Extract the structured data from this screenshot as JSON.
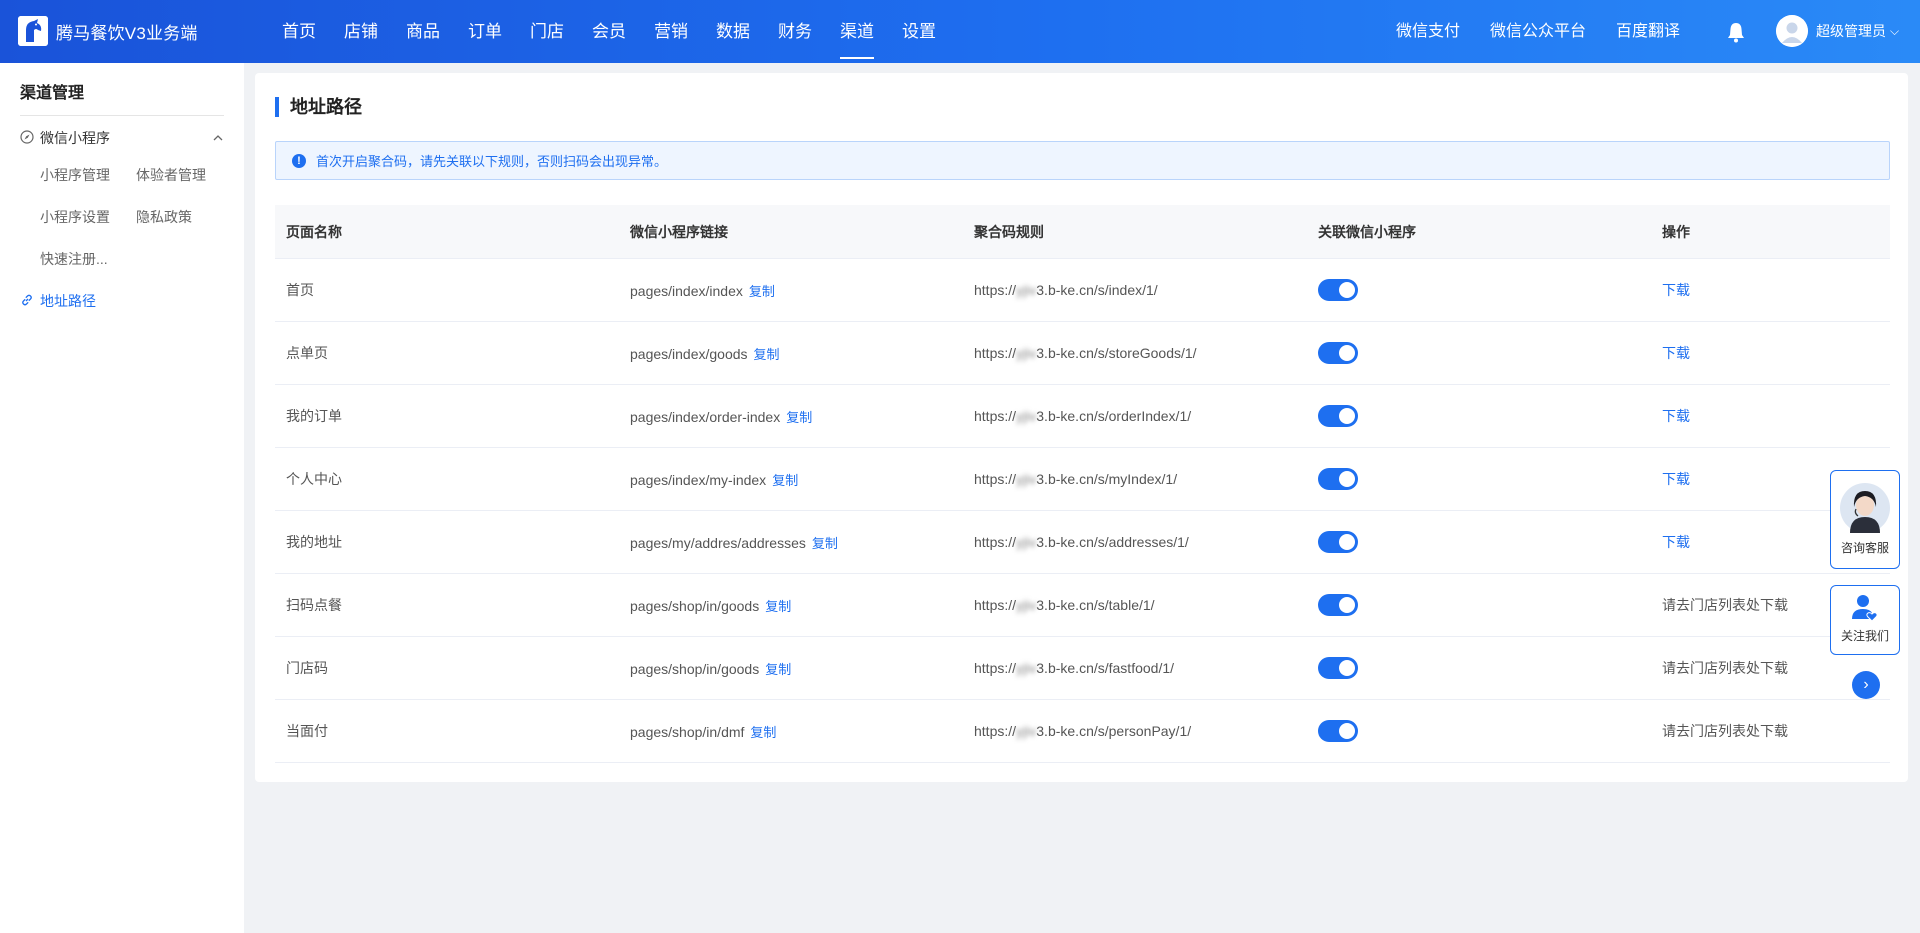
{
  "header": {
    "brand": "腾马餐饮V3业务端",
    "nav": [
      "首页",
      "店铺",
      "商品",
      "订单",
      "门店",
      "会员",
      "营销",
      "数据",
      "财务",
      "渠道",
      "设置"
    ],
    "active_nav": "渠道",
    "links": [
      "微信支付",
      "微信公众平台",
      "百度翻译"
    ],
    "user_name": "超级管理员",
    "user_caret": "⌵"
  },
  "sidebar": {
    "title": "渠道管理",
    "group_label": "微信小程序",
    "sub_items": [
      "小程序管理",
      "体验者管理",
      "小程序设置",
      "隐私政策",
      "快速注册..."
    ],
    "active_item": "地址路径"
  },
  "main": {
    "title": "地址路径",
    "notice_icon": "!",
    "notice": "首次开启聚合码，请先关联以下规则，否则扫码会出现异常。",
    "columns": [
      "页面名称",
      "微信小程序链接",
      "聚合码规则",
      "关联微信小程序",
      "操作"
    ],
    "copy_label": "复制",
    "rows": [
      {
        "name": "首页",
        "link": "pages/index/index",
        "url_prefix": "https://",
        "url_masked": "yjiv",
        "url_suffix": "3.b-ke.cn/s/index/1/",
        "enabled": true,
        "action": "下载",
        "action_is_link": true
      },
      {
        "name": "点单页",
        "link": "pages/index/goods",
        "url_prefix": "https://",
        "url_masked": "yjiv",
        "url_suffix": "3.b-ke.cn/s/storeGoods/1/",
        "enabled": true,
        "action": "下载",
        "action_is_link": true
      },
      {
        "name": "我的订单",
        "link": "pages/index/order-index",
        "url_prefix": "https://",
        "url_masked": "yjiv",
        "url_suffix": "3.b-ke.cn/s/orderIndex/1/",
        "enabled": true,
        "action": "下载",
        "action_is_link": true
      },
      {
        "name": "个人中心",
        "link": "pages/index/my-index",
        "url_prefix": "https://",
        "url_masked": "yjiv",
        "url_suffix": "3.b-ke.cn/s/myIndex/1/",
        "enabled": true,
        "action": "下载",
        "action_is_link": true
      },
      {
        "name": "我的地址",
        "link": "pages/my/addres/addresses",
        "url_prefix": "https://",
        "url_masked": "yjiv",
        "url_suffix": "3.b-ke.cn/s/addresses/1/",
        "enabled": true,
        "action": "下载",
        "action_is_link": true
      },
      {
        "name": "扫码点餐",
        "link": "pages/shop/in/goods",
        "url_prefix": "https://",
        "url_masked": "yjiv",
        "url_suffix": "3.b-ke.cn/s/table/1/",
        "enabled": true,
        "action": "请去门店列表处下载",
        "action_is_link": false
      },
      {
        "name": "门店码",
        "link": "pages/shop/in/goods",
        "url_prefix": "https://",
        "url_masked": "yjiv",
        "url_suffix": "3.b-ke.cn/s/fastfood/1/",
        "enabled": true,
        "action": "请去门店列表处下载",
        "action_is_link": false
      },
      {
        "name": "当面付",
        "link": "pages/shop/in/dmf",
        "url_prefix": "https://",
        "url_masked": "yjiv",
        "url_suffix": "3.b-ke.cn/s/personPay/1/",
        "enabled": true,
        "action": "请去门店列表处下载",
        "action_is_link": false
      }
    ]
  },
  "float": {
    "service_label": "咨询客服",
    "follow_label": "关注我们",
    "scroll_icon": "›"
  },
  "colors": {
    "primary": "#1e6ff0",
    "header_start": "#1a53d9",
    "header_end": "#2a8af7"
  }
}
